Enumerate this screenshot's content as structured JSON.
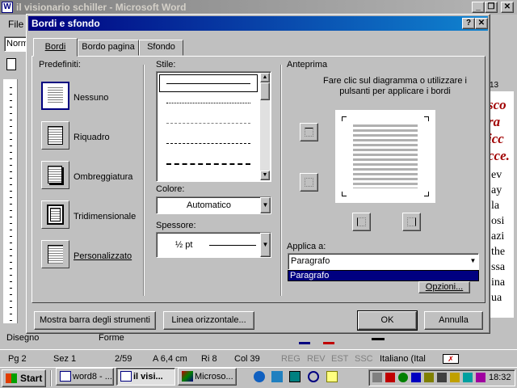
{
  "word": {
    "title": "il visionario schiller - Microsoft Word",
    "menu_first": "File",
    "style_box": "Norm",
    "ruler_num": "13",
    "red_lines": [
      "sco",
      "ra",
      "icc",
      "cce."
    ],
    "body_lines": [
      "ev",
      "ay",
      "la",
      "osi",
      "azi",
      "the",
      "ssa",
      "ina",
      "ua"
    ],
    "drawing_label": "Disegno",
    "forme_label": "Forme"
  },
  "status": {
    "page": "Pg 2",
    "section": "Sez 1",
    "pages": "2/59",
    "at": "A 6,4 cm",
    "line": "Ri 8",
    "col": "Col 39",
    "reg": "REG",
    "rev": "REV",
    "est": "EST",
    "ssc": "SSC",
    "language": "Italiano (Ital"
  },
  "dialog": {
    "title": "Bordi e sfondo",
    "tabs": [
      "Bordi",
      "Bordo pagina",
      "Sfondo"
    ],
    "presets_label": "Predefiniti:",
    "presets": [
      "Nessuno",
      "Riquadro",
      "Ombreggiatura",
      "Tridimensionale",
      "Personalizzato"
    ],
    "style_label": "Stile:",
    "color_label": "Colore:",
    "color_value": "Automatico",
    "width_label": "Spessore:",
    "width_value": "½ pt",
    "preview_label": "Anteprima",
    "preview_hint": "Fare clic sul diagramma o utilizzare i pulsanti per applicare i bordi",
    "apply_label": "Applica a:",
    "apply_value": "Paragrafo",
    "apply_options": [
      "Paragrafo"
    ],
    "options_button": "Opzioni...",
    "show_toolbar_button": "Mostra barra degli strumenti",
    "horizontal_line_button": "Linea orizzontale...",
    "ok_button": "OK",
    "cancel_button": "Annulla",
    "help_btn": "?",
    "close_btn": "✕"
  },
  "taskbar": {
    "start": "Start",
    "buttons": [
      "word8 - ...",
      "il visi...",
      "Microso..."
    ],
    "clock": "18:32"
  }
}
